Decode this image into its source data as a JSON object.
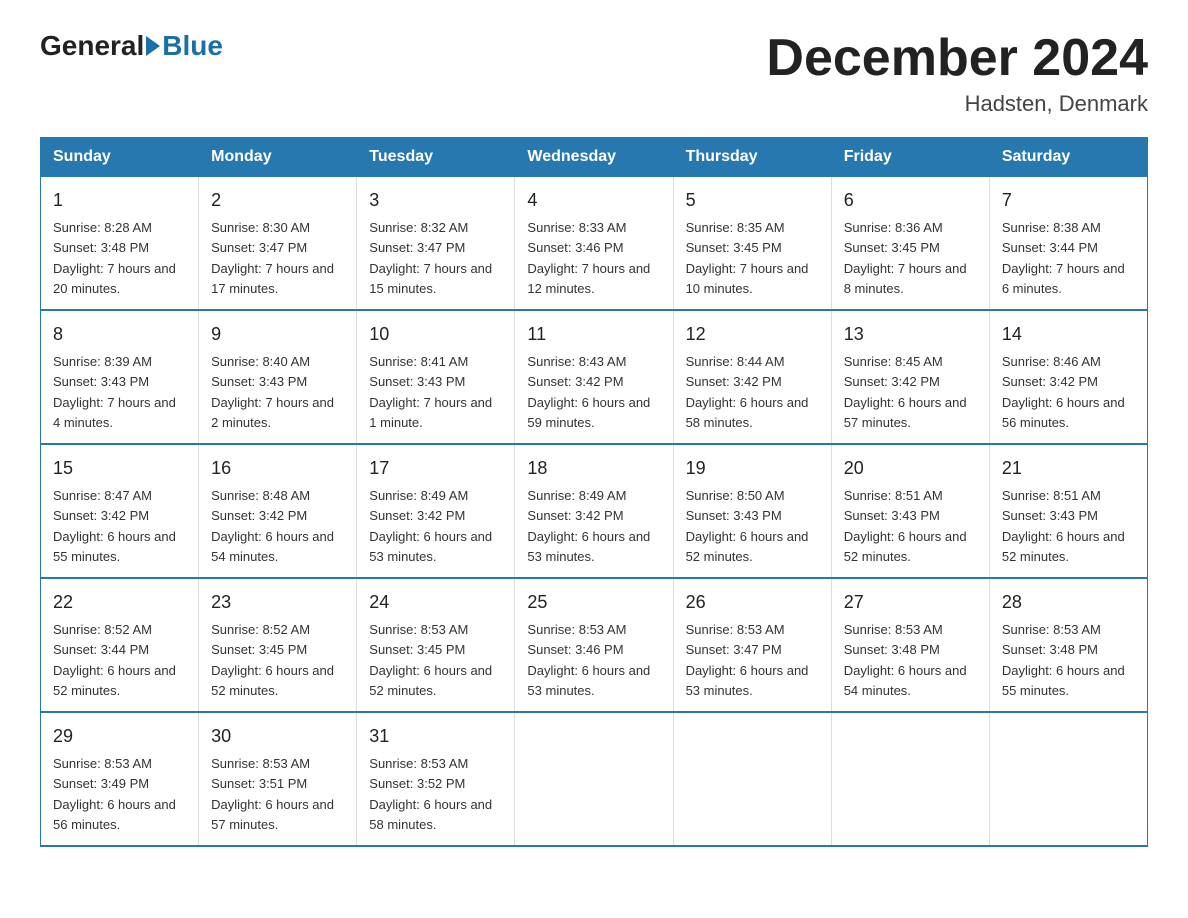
{
  "header": {
    "logo": {
      "general": "General",
      "blue": "Blue"
    },
    "title": "December 2024",
    "location": "Hadsten, Denmark"
  },
  "days_of_week": [
    "Sunday",
    "Monday",
    "Tuesday",
    "Wednesday",
    "Thursday",
    "Friday",
    "Saturday"
  ],
  "weeks": [
    [
      {
        "day": "1",
        "sunrise": "8:28 AM",
        "sunset": "3:48 PM",
        "daylight": "7 hours and 20 minutes."
      },
      {
        "day": "2",
        "sunrise": "8:30 AM",
        "sunset": "3:47 PM",
        "daylight": "7 hours and 17 minutes."
      },
      {
        "day": "3",
        "sunrise": "8:32 AM",
        "sunset": "3:47 PM",
        "daylight": "7 hours and 15 minutes."
      },
      {
        "day": "4",
        "sunrise": "8:33 AM",
        "sunset": "3:46 PM",
        "daylight": "7 hours and 12 minutes."
      },
      {
        "day": "5",
        "sunrise": "8:35 AM",
        "sunset": "3:45 PM",
        "daylight": "7 hours and 10 minutes."
      },
      {
        "day": "6",
        "sunrise": "8:36 AM",
        "sunset": "3:45 PM",
        "daylight": "7 hours and 8 minutes."
      },
      {
        "day": "7",
        "sunrise": "8:38 AM",
        "sunset": "3:44 PM",
        "daylight": "7 hours and 6 minutes."
      }
    ],
    [
      {
        "day": "8",
        "sunrise": "8:39 AM",
        "sunset": "3:43 PM",
        "daylight": "7 hours and 4 minutes."
      },
      {
        "day": "9",
        "sunrise": "8:40 AM",
        "sunset": "3:43 PM",
        "daylight": "7 hours and 2 minutes."
      },
      {
        "day": "10",
        "sunrise": "8:41 AM",
        "sunset": "3:43 PM",
        "daylight": "7 hours and 1 minute."
      },
      {
        "day": "11",
        "sunrise": "8:43 AM",
        "sunset": "3:42 PM",
        "daylight": "6 hours and 59 minutes."
      },
      {
        "day": "12",
        "sunrise": "8:44 AM",
        "sunset": "3:42 PM",
        "daylight": "6 hours and 58 minutes."
      },
      {
        "day": "13",
        "sunrise": "8:45 AM",
        "sunset": "3:42 PM",
        "daylight": "6 hours and 57 minutes."
      },
      {
        "day": "14",
        "sunrise": "8:46 AM",
        "sunset": "3:42 PM",
        "daylight": "6 hours and 56 minutes."
      }
    ],
    [
      {
        "day": "15",
        "sunrise": "8:47 AM",
        "sunset": "3:42 PM",
        "daylight": "6 hours and 55 minutes."
      },
      {
        "day": "16",
        "sunrise": "8:48 AM",
        "sunset": "3:42 PM",
        "daylight": "6 hours and 54 minutes."
      },
      {
        "day": "17",
        "sunrise": "8:49 AM",
        "sunset": "3:42 PM",
        "daylight": "6 hours and 53 minutes."
      },
      {
        "day": "18",
        "sunrise": "8:49 AM",
        "sunset": "3:42 PM",
        "daylight": "6 hours and 53 minutes."
      },
      {
        "day": "19",
        "sunrise": "8:50 AM",
        "sunset": "3:43 PM",
        "daylight": "6 hours and 52 minutes."
      },
      {
        "day": "20",
        "sunrise": "8:51 AM",
        "sunset": "3:43 PM",
        "daylight": "6 hours and 52 minutes."
      },
      {
        "day": "21",
        "sunrise": "8:51 AM",
        "sunset": "3:43 PM",
        "daylight": "6 hours and 52 minutes."
      }
    ],
    [
      {
        "day": "22",
        "sunrise": "8:52 AM",
        "sunset": "3:44 PM",
        "daylight": "6 hours and 52 minutes."
      },
      {
        "day": "23",
        "sunrise": "8:52 AM",
        "sunset": "3:45 PM",
        "daylight": "6 hours and 52 minutes."
      },
      {
        "day": "24",
        "sunrise": "8:53 AM",
        "sunset": "3:45 PM",
        "daylight": "6 hours and 52 minutes."
      },
      {
        "day": "25",
        "sunrise": "8:53 AM",
        "sunset": "3:46 PM",
        "daylight": "6 hours and 53 minutes."
      },
      {
        "day": "26",
        "sunrise": "8:53 AM",
        "sunset": "3:47 PM",
        "daylight": "6 hours and 53 minutes."
      },
      {
        "day": "27",
        "sunrise": "8:53 AM",
        "sunset": "3:48 PM",
        "daylight": "6 hours and 54 minutes."
      },
      {
        "day": "28",
        "sunrise": "8:53 AM",
        "sunset": "3:48 PM",
        "daylight": "6 hours and 55 minutes."
      }
    ],
    [
      {
        "day": "29",
        "sunrise": "8:53 AM",
        "sunset": "3:49 PM",
        "daylight": "6 hours and 56 minutes."
      },
      {
        "day": "30",
        "sunrise": "8:53 AM",
        "sunset": "3:51 PM",
        "daylight": "6 hours and 57 minutes."
      },
      {
        "day": "31",
        "sunrise": "8:53 AM",
        "sunset": "3:52 PM",
        "daylight": "6 hours and 58 minutes."
      },
      null,
      null,
      null,
      null
    ]
  ],
  "labels": {
    "sunrise": "Sunrise:",
    "sunset": "Sunset:",
    "daylight": "Daylight:"
  }
}
